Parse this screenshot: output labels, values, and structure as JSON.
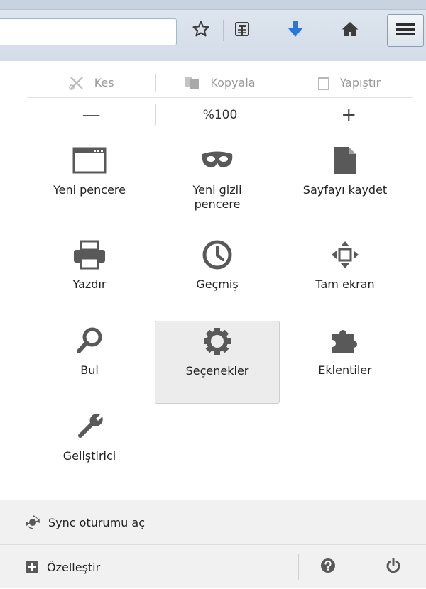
{
  "edit": {
    "cut_label": "Kes",
    "copy_label": "Kopyala",
    "paste_label": "Yapıştır"
  },
  "zoom": {
    "minus": "—",
    "level": "%100",
    "plus": "+"
  },
  "grid": {
    "new_window": "Yeni pencere",
    "private_window_line1": "Yeni gizli",
    "private_window_line2": "pencere",
    "save_page": "Sayfayı kaydet",
    "print": "Yazdır",
    "history": "Geçmiş",
    "fullscreen": "Tam ekran",
    "find": "Bul",
    "options": "Seçenekler",
    "addons": "Eklentiler",
    "developer": "Geliştirici"
  },
  "footer": {
    "sync_label": "Sync oturumu aç",
    "customize_label": "Özelleştir"
  },
  "icons": {
    "toolbar": [
      "star-icon",
      "reading-list-icon",
      "download-arrow-icon",
      "home-icon",
      "hamburger-menu-icon"
    ],
    "grid": [
      "window-icon",
      "mask-icon",
      "page-icon",
      "printer-icon",
      "clock-icon",
      "fullscreen-arrows-icon",
      "magnifier-icon",
      "gear-icon",
      "puzzle-icon",
      "wrench-icon"
    ],
    "footer": [
      "sync-icon",
      "plus-box-icon",
      "help-icon",
      "power-icon"
    ]
  },
  "colors": {
    "download_arrow": "#2a78d6",
    "selected_bg": "#ececec",
    "footer_bg": "#f1f1f1",
    "icon_gray": "#595959"
  }
}
